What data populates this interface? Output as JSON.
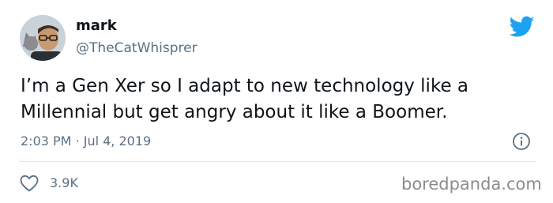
{
  "tweet": {
    "display_name": "mark",
    "handle": "@TheCatWhisprer",
    "text": "I’m a Gen Xer so I adapt to new technology like a Millennial but get angry about it like a Boomer.",
    "timestamp": "2:03 PM · Jul 4, 2019",
    "like_count": "3.9K"
  },
  "watermark": "boredpanda.com",
  "icons": {
    "brand": "twitter-bird-icon",
    "info": "info-icon",
    "like": "heart-icon"
  },
  "colors": {
    "brand_blue": "#1da1f2",
    "secondary_text": "#5b7083",
    "primary_text": "#0f1419",
    "divider": "#e1e8ed"
  }
}
